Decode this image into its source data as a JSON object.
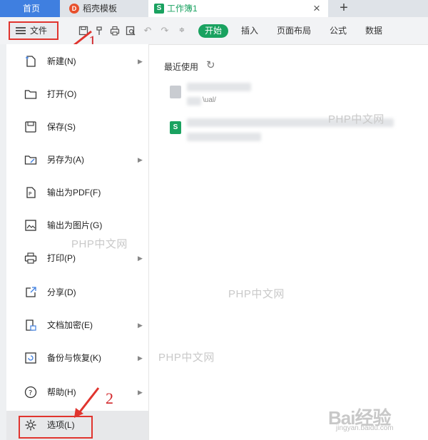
{
  "tabs": {
    "home": "首页",
    "template": "稻壳模板",
    "sheet": "工作簿1",
    "close": "×",
    "add": "+"
  },
  "toolbar": {
    "file_label": "文件",
    "ribbon_tabs": [
      "开始",
      "插入",
      "页面布局",
      "公式",
      "数据"
    ]
  },
  "menu": {
    "items": [
      {
        "label": "新建(N)",
        "icon": "new-file-icon",
        "has_arrow": true
      },
      {
        "label": "打开(O)",
        "icon": "folder-open-icon",
        "has_arrow": false
      },
      {
        "label": "保存(S)",
        "icon": "save-icon",
        "has_arrow": false
      },
      {
        "label": "另存为(A)",
        "icon": "save-as-icon",
        "has_arrow": true
      },
      {
        "label": "输出为PDF(F)",
        "icon": "export-pdf-icon",
        "has_arrow": false
      },
      {
        "label": "输出为图片(G)",
        "icon": "export-image-icon",
        "has_arrow": false
      },
      {
        "label": "打印(P)",
        "icon": "printer-icon",
        "has_arrow": true
      },
      {
        "label": "分享(D)",
        "icon": "share-icon",
        "has_arrow": false
      },
      {
        "label": "文档加密(E)",
        "icon": "encrypt-icon",
        "has_arrow": true
      },
      {
        "label": "备份与恢复(K)",
        "icon": "backup-icon",
        "has_arrow": true
      },
      {
        "label": "帮助(H)",
        "icon": "help-icon",
        "has_arrow": true
      },
      {
        "label": "选项(L)",
        "icon": "gear-icon",
        "has_arrow": false
      }
    ]
  },
  "recent": {
    "title": "最近使用",
    "file1_suffix": "\\ual/"
  },
  "annotations": {
    "num1": "1",
    "num2": "2"
  },
  "watermarks": {
    "text": "PHP中文网",
    "baidu": "Bai经验",
    "baidu_url": "jingyan.baidu.com"
  },
  "colors": {
    "accent_green": "#1aa260",
    "home_tab_blue": "#3f7fe0",
    "annotation_red": "#e0342e"
  }
}
